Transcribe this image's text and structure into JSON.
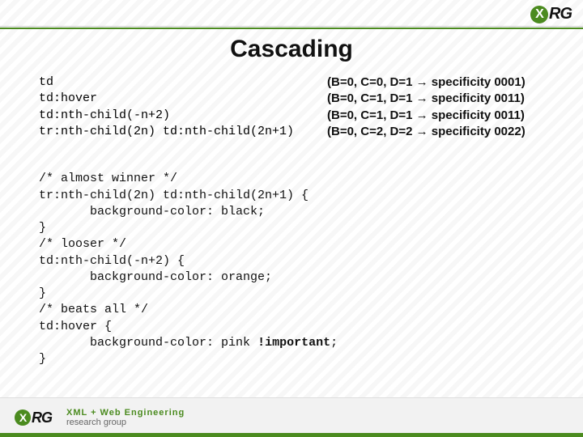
{
  "header": {
    "title": "Cascading",
    "logo_text_main": "RG",
    "logo_mark": "X"
  },
  "specificity_rows": [
    {
      "selector": "td",
      "spec": "(B=0, C=0, D=1 → specificity 0001)"
    },
    {
      "selector": "td:hover",
      "spec": "(B=0, C=1, D=1 → specificity 0011)"
    },
    {
      "selector": "td:nth-child(-n+2)",
      "spec": "(B=0, C=1, D=1 → specificity 0011)"
    },
    {
      "selector": "tr:nth-child(2n) td:nth-child(2n+1)",
      "spec": "(B=0, C=2, D=2 → specificity 0022)"
    }
  ],
  "code": {
    "c1": "/* almost winner */",
    "l1": "tr:nth-child(2n) td:nth-child(2n+1) {",
    "l2": "       background-color: black;",
    "l3": "}",
    "c2": "/* looser */",
    "l4": "td:nth-child(-n+2) {",
    "l5": "       background-color: orange;",
    "l6": "}",
    "c3": "/* beats all */",
    "l7": "td:hover {",
    "l8a": "       background-color: pink ",
    "l8b": "!important",
    "l8c": ";",
    "l9": "}"
  },
  "footer": {
    "sublogo_top": "XML + Web Engineering",
    "sublogo_bottom": "research group"
  }
}
